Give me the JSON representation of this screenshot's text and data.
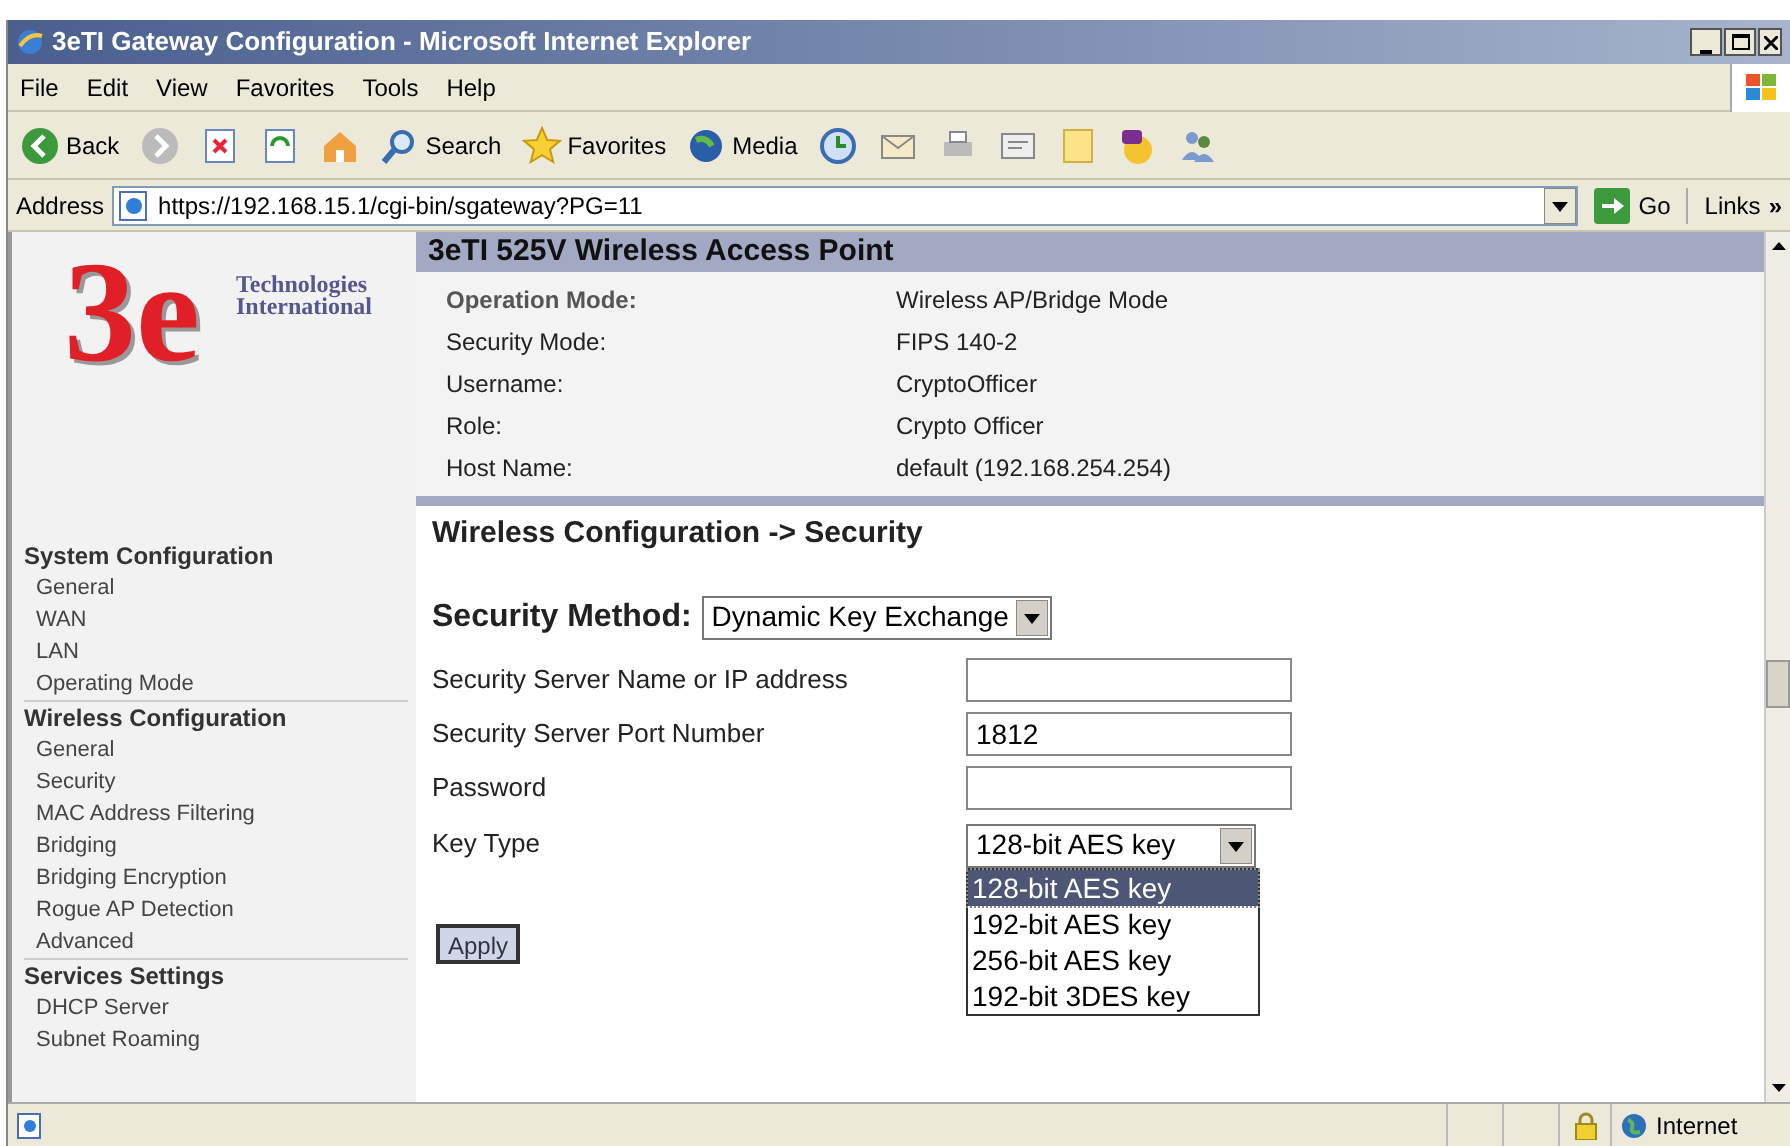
{
  "window": {
    "title": "3eTI Gateway Configuration - Microsoft Internet Explorer"
  },
  "menu_bar": [
    "File",
    "Edit",
    "View",
    "Favorites",
    "Tools",
    "Help"
  ],
  "toolbar": [
    {
      "kind": "back",
      "label": "Back"
    },
    {
      "kind": "forward"
    },
    {
      "kind": "stop"
    },
    {
      "kind": "refresh"
    },
    {
      "kind": "home"
    },
    {
      "kind": "search",
      "label": "Search"
    },
    {
      "kind": "favorites",
      "label": "Favorites"
    },
    {
      "kind": "media",
      "label": "Media"
    },
    {
      "kind": "history"
    },
    {
      "kind": "mail"
    },
    {
      "kind": "print"
    },
    {
      "kind": "edit"
    },
    {
      "kind": "note"
    },
    {
      "kind": "messenger"
    },
    {
      "kind": "users"
    }
  ],
  "address_bar": {
    "label": "Address",
    "url": "https://192.168.15.1/cgi-bin/sgateway?PG=11",
    "go": "Go",
    "links": "Links",
    "links_more": "»"
  },
  "logo": {
    "mark": "3e",
    "line_1": "Technologies",
    "line_2": "International"
  },
  "sidebar": [
    {
      "heading": "System Configuration",
      "items": [
        "General",
        "WAN",
        "LAN",
        "Operating Mode"
      ]
    },
    {
      "heading": "Wireless Configuration",
      "items": [
        "General",
        "Security",
        "MAC Address Filtering",
        "Bridging",
        "Bridging Encryption",
        "Rogue AP Detection",
        "Advanced"
      ]
    },
    {
      "heading": "Services Settings",
      "items": [
        "DHCP Server",
        "Subnet Roaming"
      ]
    }
  ],
  "header": {
    "title": "3eTI 525V Wireless Access Point",
    "rows": [
      {
        "label": "Operation Mode:",
        "value": "Wireless AP/Bridge Mode",
        "bold": true
      },
      {
        "label": "Security Mode:",
        "value": "FIPS 140-2",
        "bold": false
      },
      {
        "label": "Username:",
        "value": "CryptoOfficer",
        "bold": false
      },
      {
        "label": "Role:",
        "value": "Crypto Officer",
        "bold": false
      },
      {
        "label": "Host Name:",
        "value": "default (192.168.254.254)",
        "bold": false
      }
    ]
  },
  "section_title": "Wireless Configuration -> Security",
  "security_method": {
    "label": "Security Method:",
    "value": "Dynamic Key Exchange"
  },
  "fields": [
    {
      "label": "Security Server Name or IP address"
    },
    {
      "label": "Security Server Port Number",
      "value": "1812"
    },
    {
      "label": "Password"
    }
  ],
  "key_type": {
    "label": "Key Type",
    "value": "128-bit AES key",
    "options": [
      {
        "label": "128-bit AES key",
        "selected": true
      },
      {
        "label": "192-bit AES key",
        "selected": false
      },
      {
        "label": "256-bit AES key",
        "selected": false
      },
      {
        "label": "192-bit 3DES key",
        "selected": false
      }
    ]
  },
  "apply_button": "Apply",
  "status_bar": {
    "secure": true,
    "zone": "Internet"
  }
}
